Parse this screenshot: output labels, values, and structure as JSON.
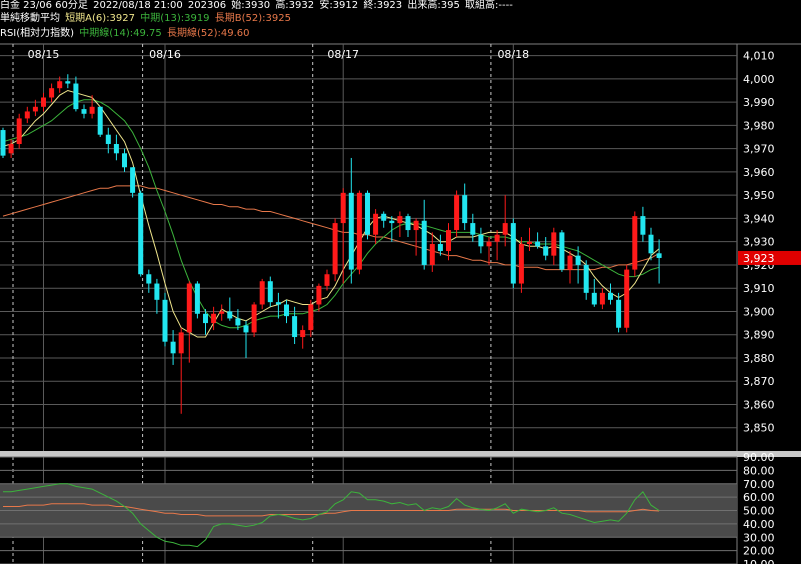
{
  "header": {
    "line1": {
      "symbol": "白金 23/06 60分足",
      "datetime": "2022/08/18 21:00",
      "contract": "202306",
      "open": "始:3930",
      "high": "高:3932",
      "low": "安:3912",
      "close": "終:3923",
      "volume": "出来高:395",
      "oi": "取組高:----"
    },
    "line2": {
      "name": "単純移動平均",
      "short": "短期A(6):3927",
      "mid": "中期(13):3919",
      "long": "長期B(52):3925"
    },
    "line3": {
      "name": "RSI(相対力指数)",
      "mid": "中期線(14):49.75",
      "long": "長期線(52):49.60"
    }
  },
  "colors": {
    "up": "#ff1a1a",
    "down": "#22e6f0",
    "ma_short": "#f0e68c",
    "ma_mid": "#3cb43c",
    "ma_long": "#e8784a",
    "rsi_mid": "#3cb43c",
    "rsi_long": "#e8784a",
    "price_tag": "#e00000"
  },
  "price_tag": "3,923",
  "chart_data": [
    {
      "type": "candlestick",
      "x_labels": [
        {
          "label": "08/15",
          "index": 5
        },
        {
          "label": "08/16",
          "index": 20
        },
        {
          "label": "08/17",
          "index": 42
        },
        {
          "label": "08/18",
          "index": 63
        }
      ],
      "day_separators": [
        0,
        16,
        37,
        59
      ],
      "ylim": [
        3840,
        4015
      ],
      "yticks": [
        "3,850",
        "3,860",
        "3,870",
        "3,880",
        "3,890",
        "3,900",
        "3,910",
        "3,920",
        "3,930",
        "3,940",
        "3,950",
        "3,960",
        "3,970",
        "3,980",
        "3,990",
        "4,000",
        "4,010"
      ],
      "ytick_values": [
        3850,
        3860,
        3870,
        3880,
        3890,
        3900,
        3910,
        3920,
        3930,
        3940,
        3950,
        3960,
        3970,
        3980,
        3990,
        4000,
        4010
      ],
      "ohlc": [
        [
          3978,
          3979,
          3966,
          3967
        ],
        [
          3968,
          3974,
          3966,
          3972
        ],
        [
          3972,
          3985,
          3970,
          3983
        ],
        [
          3983,
          3988,
          3981,
          3986
        ],
        [
          3986,
          3991,
          3984,
          3988
        ],
        [
          3988,
          3994,
          3986,
          3992
        ],
        [
          3992,
          3998,
          3990,
          3996
        ],
        [
          3996,
          4001,
          3994,
          3999
        ],
        [
          3999,
          4002,
          3996,
          3998
        ],
        [
          3998,
          4001,
          3986,
          3987
        ],
        [
          3987,
          3989,
          3983,
          3985
        ],
        [
          3985,
          3993,
          3983,
          3988
        ],
        [
          3988,
          3988,
          3975,
          3976
        ],
        [
          3976,
          3979,
          3968,
          3972
        ],
        [
          3972,
          3976,
          3965,
          3968
        ],
        [
          3968,
          3970,
          3960,
          3962
        ],
        [
          3962,
          3962,
          3949,
          3951
        ],
        [
          3951,
          3952,
          3915,
          3916
        ],
        [
          3916,
          3918,
          3908,
          3912
        ],
        [
          3912,
          3914,
          3899,
          3905
        ],
        [
          3905,
          3908,
          3885,
          3887
        ],
        [
          3887,
          3892,
          3877,
          3882
        ],
        [
          3882,
          3893,
          3856,
          3891
        ],
        [
          3891,
          3913,
          3878,
          3912
        ],
        [
          3912,
          3913,
          3897,
          3899
        ],
        [
          3899,
          3901,
          3890,
          3895
        ],
        [
          3895,
          3902,
          3892,
          3899
        ],
        [
          3899,
          3903,
          3896,
          3900
        ],
        [
          3900,
          3906,
          3896,
          3897
        ],
        [
          3897,
          3901,
          3892,
          3894
        ],
        [
          3894,
          3896,
          3880,
          3891
        ],
        [
          3891,
          3904,
          3889,
          3903
        ],
        [
          3903,
          3914,
          3901,
          3913
        ],
        [
          3913,
          3915,
          3902,
          3904
        ],
        [
          3904,
          3908,
          3897,
          3903
        ],
        [
          3903,
          3905,
          3895,
          3898
        ],
        [
          3898,
          3902,
          3886,
          3889
        ],
        [
          3889,
          3894,
          3884,
          3892
        ],
        [
          3892,
          3905,
          3889,
          3903
        ],
        [
          3903,
          3912,
          3900,
          3911
        ],
        [
          3911,
          3918,
          3909,
          3916
        ],
        [
          3916,
          3940,
          3913,
          3938
        ],
        [
          3938,
          3953,
          3912,
          3951
        ],
        [
          3951,
          3966,
          3912,
          3918
        ],
        [
          3918,
          3952,
          3916,
          3951
        ],
        [
          3951,
          3952,
          3931,
          3933
        ],
        [
          3933,
          3944,
          3929,
          3942
        ],
        [
          3942,
          3943,
          3936,
          3939
        ],
        [
          3939,
          3941,
          3930,
          3938
        ],
        [
          3938,
          3943,
          3932,
          3941
        ],
        [
          3941,
          3942,
          3932,
          3935
        ],
        [
          3935,
          3940,
          3924,
          3939
        ],
        [
          3939,
          3948,
          3918,
          3920
        ],
        [
          3920,
          3934,
          3917,
          3929
        ],
        [
          3929,
          3933,
          3924,
          3926
        ],
        [
          3926,
          3938,
          3922,
          3935
        ],
        [
          3935,
          3952,
          3932,
          3950
        ],
        [
          3950,
          3955,
          3935,
          3938
        ],
        [
          3938,
          3942,
          3930,
          3933
        ],
        [
          3933,
          3936,
          3925,
          3928
        ],
        [
          3928,
          3932,
          3920,
          3930
        ],
        [
          3930,
          3935,
          3922,
          3933
        ],
        [
          3933,
          3950,
          3928,
          3938
        ],
        [
          3938,
          3940,
          3910,
          3912
        ],
        [
          3912,
          3932,
          3908,
          3929
        ],
        [
          3929,
          3936,
          3926,
          3930
        ],
        [
          3930,
          3934,
          3927,
          3928
        ],
        [
          3928,
          3932,
          3922,
          3924
        ],
        [
          3924,
          3936,
          3920,
          3934
        ],
        [
          3934,
          3935,
          3917,
          3918
        ],
        [
          3918,
          3926,
          3912,
          3924
        ],
        [
          3924,
          3928,
          3912,
          3920
        ],
        [
          3920,
          3922,
          3905,
          3908
        ],
        [
          3908,
          3914,
          3902,
          3903
        ],
        [
          3903,
          3910,
          3901,
          3908
        ],
        [
          3908,
          3912,
          3903,
          3905
        ],
        [
          3905,
          3908,
          3891,
          3893
        ],
        [
          3893,
          3920,
          3891,
          3918
        ],
        [
          3918,
          3943,
          3915,
          3941
        ],
        [
          3941,
          3945,
          3930,
          3933
        ],
        [
          3933,
          3936,
          3922,
          3925
        ],
        [
          3925,
          3931,
          3912,
          3923
        ]
      ],
      "ma_short": [
        3971,
        3972,
        3974,
        3978,
        3982,
        3985,
        3989,
        3993,
        3995,
        3994,
        3993,
        3992,
        3988,
        3983,
        3978,
        3973,
        3964,
        3950,
        3937,
        3925,
        3912,
        3900,
        3893,
        3891,
        3889,
        3889,
        3895,
        3901,
        3899,
        3897,
        3896,
        3898,
        3900,
        3902,
        3903,
        3905,
        3904,
        3903,
        3903,
        3905,
        3906,
        3911,
        3918,
        3924,
        3930,
        3936,
        3940,
        3941,
        3940,
        3939,
        3938,
        3937,
        3935,
        3933,
        3930,
        3930,
        3932,
        3932,
        3932,
        3933,
        3934,
        3934,
        3934,
        3932,
        3929,
        3928,
        3928,
        3927,
        3928,
        3927,
        3925,
        3923,
        3920,
        3915,
        3911,
        3908,
        3906,
        3908,
        3912,
        3918,
        3924,
        3927
      ],
      "ma_mid": [
        3973,
        3974,
        3975,
        3976,
        3978,
        3980,
        3982,
        3985,
        3988,
        3990,
        3991,
        3991,
        3990,
        3988,
        3985,
        3982,
        3977,
        3970,
        3962,
        3952,
        3943,
        3933,
        3922,
        3913,
        3906,
        3900,
        3896,
        3894,
        3893,
        3893,
        3894,
        3896,
        3897,
        3898,
        3898,
        3899,
        3899,
        3899,
        3900,
        3901,
        3903,
        3907,
        3912,
        3916,
        3920,
        3925,
        3929,
        3932,
        3935,
        3937,
        3938,
        3938,
        3937,
        3936,
        3935,
        3934,
        3934,
        3934,
        3934,
        3933,
        3932,
        3932,
        3932,
        3931,
        3930,
        3930,
        3929,
        3929,
        3929,
        3928,
        3927,
        3926,
        3924,
        3922,
        3920,
        3918,
        3916,
        3915,
        3915,
        3916,
        3918,
        3919
      ],
      "ma_long": [
        3941,
        3942,
        3943,
        3944,
        3945,
        3946,
        3947,
        3948,
        3949,
        3950,
        3951,
        3952,
        3953,
        3953,
        3954,
        3954,
        3954,
        3954,
        3953,
        3953,
        3952,
        3951,
        3950,
        3949,
        3948,
        3947,
        3946,
        3946,
        3945,
        3945,
        3944,
        3944,
        3943,
        3943,
        3942,
        3941,
        3940,
        3939,
        3938,
        3937,
        3936,
        3935,
        3934,
        3934,
        3933,
        3933,
        3932,
        3932,
        3931,
        3930,
        3929,
        3928,
        3927,
        3926,
        3925,
        3924,
        3924,
        3923,
        3922,
        3922,
        3921,
        3921,
        3920,
        3920,
        3919,
        3919,
        3919,
        3918,
        3918,
        3918,
        3918,
        3918,
        3918,
        3918,
        3919,
        3919,
        3920,
        3920,
        3921,
        3922,
        3923,
        3925
      ]
    },
    {
      "type": "line",
      "title": "RSI",
      "ylim": [
        10,
        90
      ],
      "yticks": [
        "10.00",
        "20.00",
        "30.00",
        "40.00",
        "50.00",
        "60.00",
        "70.00",
        "80.00",
        "90.00"
      ],
      "ytick_values": [
        10,
        20,
        30,
        40,
        50,
        60,
        70,
        80,
        90
      ],
      "bands": [
        [
          30,
          70
        ]
      ],
      "rsi_mid": [
        64,
        64,
        65,
        66,
        67,
        68,
        69,
        70,
        70,
        68,
        67,
        66,
        63,
        60,
        57,
        53,
        48,
        40,
        35,
        30,
        27,
        26,
        24,
        24,
        23,
        28,
        38,
        40,
        40,
        39,
        38,
        39,
        41,
        46,
        47,
        46,
        44,
        43,
        44,
        47,
        49,
        55,
        58,
        64,
        63,
        58,
        58,
        57,
        55,
        56,
        54,
        55,
        50,
        52,
        51,
        53,
        59,
        54,
        52,
        51,
        50,
        52,
        55,
        48,
        51,
        50,
        49,
        50,
        52,
        48,
        47,
        45,
        43,
        41,
        42,
        43,
        42,
        48,
        58,
        64,
        54,
        50
      ],
      "rsi_long": [
        53,
        53,
        53,
        54,
        54,
        54,
        55,
        55,
        55,
        55,
        55,
        54,
        54,
        54,
        53,
        53,
        52,
        51,
        50,
        49,
        48,
        48,
        47,
        47,
        47,
        46,
        46,
        46,
        46,
        46,
        46,
        46,
        46,
        47,
        47,
        47,
        47,
        47,
        47,
        47,
        48,
        48,
        49,
        50,
        50,
        50,
        50,
        50,
        50,
        50,
        50,
        50,
        50,
        50,
        50,
        50,
        51,
        51,
        51,
        51,
        51,
        51,
        51,
        50,
        50,
        50,
        50,
        50,
        50,
        50,
        50,
        50,
        49,
        49,
        49,
        49,
        49,
        49,
        50,
        51,
        50,
        49.6
      ]
    }
  ]
}
